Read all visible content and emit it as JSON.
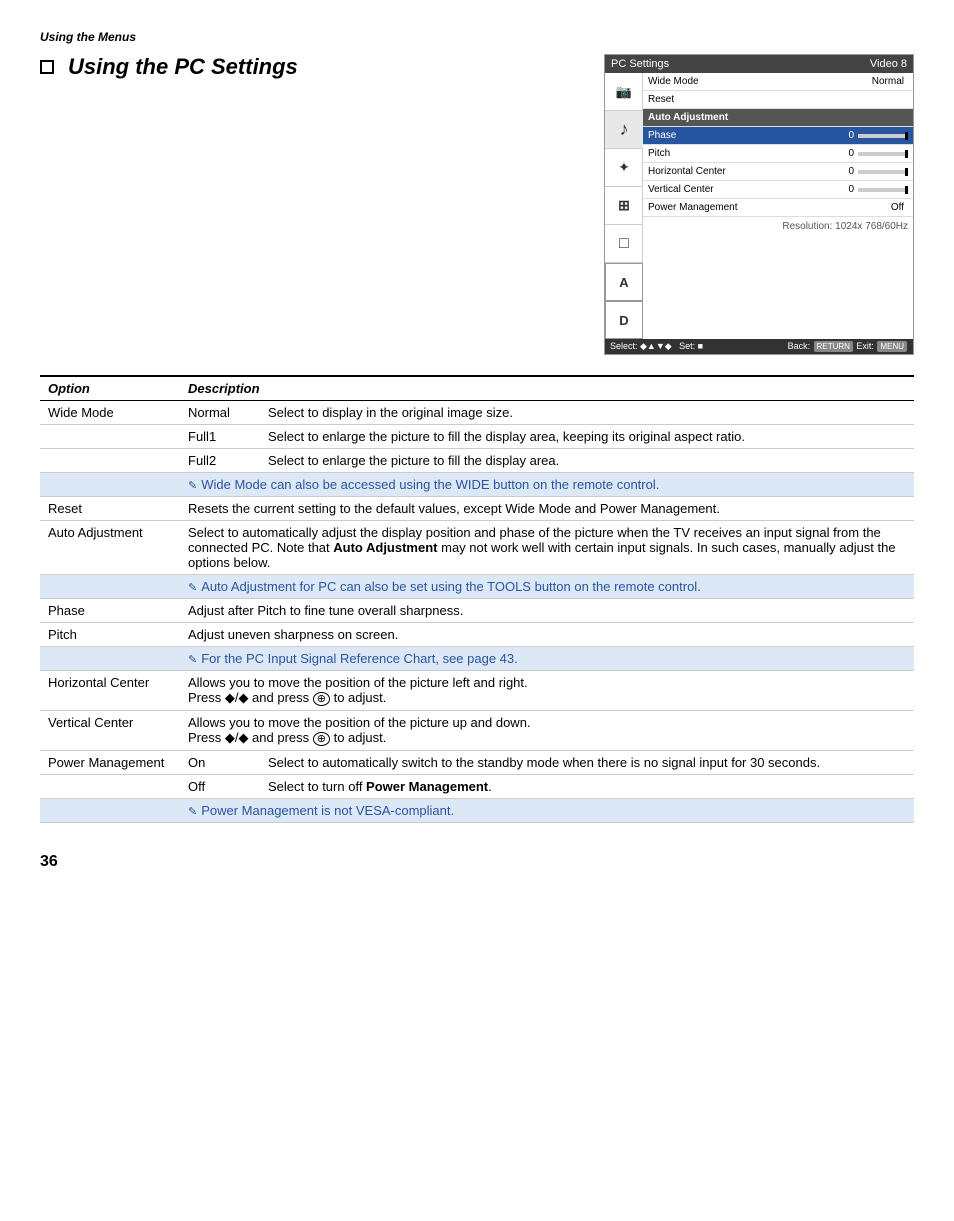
{
  "header": {
    "breadcrumb": "Using the Menus"
  },
  "title": {
    "checkbox_label": "□",
    "text": "Using the PC Settings"
  },
  "panel": {
    "title": "PC Settings",
    "source": "Video 8",
    "icons": [
      {
        "symbol": "📷",
        "label": "camera-icon"
      },
      {
        "symbol": "♪",
        "label": "audio-icon"
      },
      {
        "symbol": "✦",
        "label": "star-icon"
      },
      {
        "symbol": "⊞",
        "label": "grid-icon"
      },
      {
        "symbol": "□",
        "label": "screen-icon"
      },
      {
        "symbol": "A",
        "label": "text-icon"
      },
      {
        "symbol": "D",
        "label": "d-icon"
      }
    ],
    "menu_items": [
      {
        "label": "Wide Mode",
        "value": "Normal",
        "type": "header"
      },
      {
        "label": "Reset",
        "value": "",
        "type": "normal"
      },
      {
        "label": "Auto Adjustment",
        "value": "",
        "type": "section"
      },
      {
        "label": "Phase",
        "value": "0",
        "type": "slider"
      },
      {
        "label": "Pitch",
        "value": "0",
        "type": "slider"
      },
      {
        "label": "Horizontal Center",
        "value": "0",
        "type": "slider"
      },
      {
        "label": "Vertical Center",
        "value": "0",
        "type": "slider"
      },
      {
        "label": "Power Management",
        "value": "Off",
        "type": "normal"
      }
    ],
    "resolution": "Resolution: 1024x 768/60Hz",
    "footer": {
      "select": "Select: ◆▲▼◆",
      "set": "Set: ■",
      "back_label": "Back:",
      "back_key": "RETURN",
      "exit_label": "Exit:",
      "exit_key": "MENU"
    }
  },
  "table": {
    "col1_header": "Option",
    "col2_header": "Description",
    "rows": [
      {
        "option": "Wide Mode",
        "sub_option": "Normal",
        "description": "Select to display in the original image size.",
        "type": "normal"
      },
      {
        "option": "",
        "sub_option": "Full1",
        "description": "Select to enlarge the picture to fill the display area, keeping its original aspect ratio.",
        "type": "normal"
      },
      {
        "option": "",
        "sub_option": "Full2",
        "description": "Select to enlarge the picture to fill the display area.",
        "type": "normal"
      },
      {
        "option": "",
        "sub_option": "",
        "description": "Wide Mode can also be accessed using the WIDE button on the remote control.",
        "type": "note"
      },
      {
        "option": "Reset",
        "sub_option": "",
        "description": "Resets the current setting to the default values, except Wide Mode and Power Management.",
        "type": "normal"
      },
      {
        "option": "Auto Adjustment",
        "sub_option": "",
        "description": "Select to automatically adjust the display position and phase of the picture when the TV receives an input signal from the connected PC. Note that Auto Adjustment may not work well with certain input signals. In such cases, manually adjust the options below.",
        "type": "normal"
      },
      {
        "option": "",
        "sub_option": "",
        "description": "Auto Adjustment for PC can also be set using the TOOLS button on the remote control.",
        "type": "note"
      },
      {
        "option": "Phase",
        "sub_option": "",
        "description": "Adjust after Pitch to fine tune overall sharpness.",
        "type": "normal"
      },
      {
        "option": "Pitch",
        "sub_option": "",
        "description": "Adjust uneven sharpness on screen.",
        "type": "normal"
      },
      {
        "option": "",
        "sub_option": "",
        "description": "For the PC Input Signal Reference Chart, see page 43.",
        "type": "note"
      },
      {
        "option": "Horizontal Center",
        "sub_option": "",
        "description": "Allows you to move the position of the picture left and right.\nPress ◆/◆ and press ⊕ to adjust.",
        "type": "normal"
      },
      {
        "option": "Vertical Center",
        "sub_option": "",
        "description": "Allows you to move the position of the picture up and down.\nPress ◆/◆ and press ⊕ to adjust.",
        "type": "normal"
      },
      {
        "option": "Power Management",
        "sub_option": "On",
        "description": "Select to automatically switch to the standby mode when there is no signal input for 30 seconds.",
        "type": "normal"
      },
      {
        "option": "",
        "sub_option": "Off",
        "description": "Select to turn off Power Management.",
        "type": "normal"
      },
      {
        "option": "",
        "sub_option": "",
        "description": "Power Management is not VESA-compliant.",
        "type": "note"
      }
    ]
  },
  "page_number": "36"
}
